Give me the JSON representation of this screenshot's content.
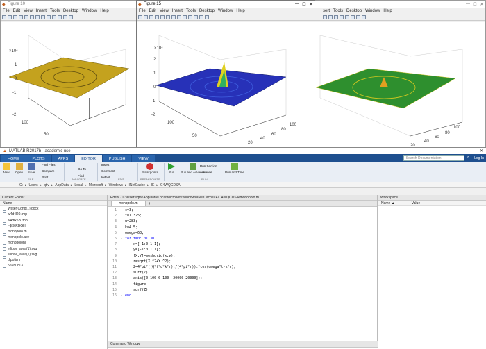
{
  "fig1": {
    "title": "Figure 10",
    "menu": [
      "File",
      "Edit",
      "View",
      "Insert",
      "Tools",
      "Desktop",
      "Window",
      "Help"
    ],
    "exp": "×10⁴",
    "zt": [
      "1",
      "0",
      "-1",
      "-2"
    ],
    "xt": [
      "50",
      "100"
    ],
    "color": "#c4a21e"
  },
  "fig2": {
    "title": "Figure 15",
    "menu": [
      "File",
      "Edit",
      "View",
      "Insert",
      "Tools",
      "Desktop",
      "Window",
      "Help"
    ],
    "exp": "×10⁴",
    "zt": [
      "2",
      "1",
      "0",
      "-1",
      "-2"
    ],
    "xt": [
      "50",
      "100"
    ],
    "yt": [
      "20",
      "40",
      "60",
      "80",
      "100"
    ],
    "color": "#2731b8"
  },
  "fig3": {
    "menu": [
      "sert",
      "Tools",
      "Desktop",
      "Window",
      "Help"
    ],
    "xt": [
      "100",
      "80",
      "60",
      "40",
      "20"
    ],
    "color": "#2e8f2e"
  },
  "matlab": {
    "title": "MATLAB R2017b - academic use",
    "tabs": [
      "HOME",
      "PLOTS",
      "APPS",
      "EDITOR",
      "PUBLISH",
      "VIEW"
    ],
    "search": "Search Documentation",
    "login": "Log In",
    "ribbon": {
      "new": "New",
      "open": "Open",
      "save": "Save",
      "findfiles": "Find Files",
      "compare": "Compare",
      "print": "Print",
      "goto": "Go To",
      "comment": "Comment",
      "indent": "Indent",
      "find": "Find",
      "insert": "Insert",
      "breakpoints": "Breakpoints",
      "run": "Run",
      "runadv": "Run and Advance",
      "runsection": "Run Section",
      "advance": "Advance",
      "runtime": "Run and Time",
      "g_file": "FILE",
      "g_nav": "NAVIGATE",
      "g_edit": "EDIT",
      "g_bp": "BREAKPOINTS",
      "g_run": "RUN"
    },
    "path": [
      "C:",
      "Users",
      "qtiv",
      "AppData",
      "Local",
      "Microsoft",
      "Windows",
      "INetCache",
      "IE",
      "C4WQCDSA"
    ],
    "folder": {
      "title": "Current Folder",
      "name": "Name",
      "files": [
        "Water Cong(1).docx",
        "w4d4R0.tmp",
        "w4dR5B.tmp",
        "~$ 9tRBGH",
        "monopolo.m",
        "monopolo.asv",
        "monopoloni",
        "ellipse_area(1).svg",
        "ellipse_area(1).svg",
        "dlpolism",
        "555b0c13"
      ]
    },
    "editor": {
      "title": "Editor - C:\\Users\\qtiv\\AppData\\Local\\Microsoft\\Windows\\INetCache\\IE\\C4WQCDSA\\monopolo.m",
      "tab": "monopolo.m",
      "lines": [
        "c=3;",
        "t=1.325;",
        "u=283;",
        "k=4.5;",
        "omega=60;",
        "for t=0:.01:30",
        "    x=[-1:0.1:1];",
        "    y=[-1:0.1:1];",
        "    [X,Y]=meshgrid(x,y);",
        "    r=sqrt(X.^2+Y.^2);",
        "    Z=4*pi*((Q*t*u*k*r)./(4*pi*r)).*cos(omega*t-k*r);",
        "    surf(Z);",
        "    axis([0 100 0 100 -20000 20000]);",
        "    figure",
        "    surf(Z)",
        "end"
      ],
      "markers": [
        "",
        "",
        "",
        "",
        "",
        "-",
        "",
        "",
        "",
        "",
        "",
        "",
        "",
        "",
        "",
        "-"
      ]
    },
    "cmd": "Command Window",
    "ws": {
      "title": "Workspace",
      "name": "Name ▲",
      "value": "Value"
    }
  }
}
